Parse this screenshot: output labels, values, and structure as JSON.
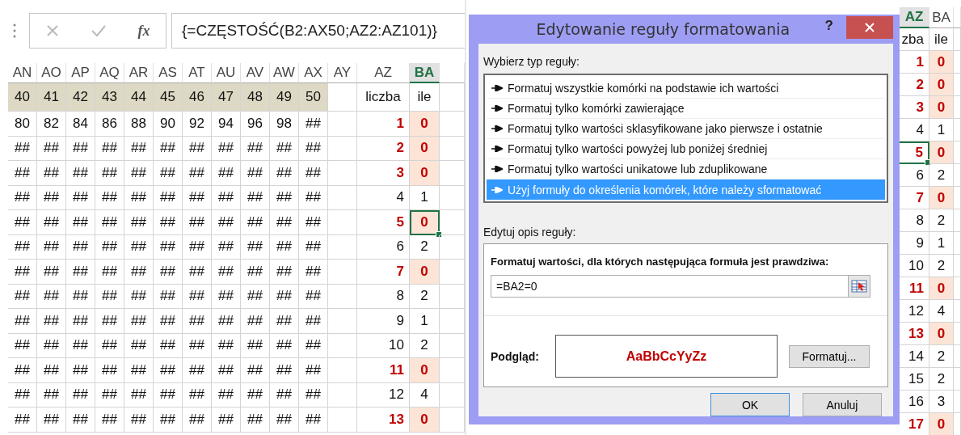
{
  "left_sheet": {
    "formula_bar": {
      "function_label": "fx",
      "formula": "{=CZĘSTOŚĆ(B2:AX50;AZ2:AZ101)}"
    },
    "columns": [
      {
        "label": "AN",
        "selected": false
      },
      {
        "label": "AO",
        "selected": false
      },
      {
        "label": "AP",
        "selected": false
      },
      {
        "label": "AQ",
        "selected": false
      },
      {
        "label": "AR",
        "selected": false
      },
      {
        "label": "AS",
        "selected": false
      },
      {
        "label": "AT",
        "selected": false
      },
      {
        "label": "AU",
        "selected": false
      },
      {
        "label": "AV",
        "selected": false
      },
      {
        "label": "AW",
        "selected": false
      },
      {
        "label": "AX",
        "selected": false
      },
      {
        "label": "AY",
        "selected": false
      },
      {
        "label": "AZ",
        "selected": false
      },
      {
        "label": "BA",
        "selected": true
      }
    ],
    "header_row": {
      "cells": [
        "40",
        "41",
        "42",
        "43",
        "44",
        "45",
        "46",
        "47",
        "48",
        "49",
        "50"
      ],
      "az": "liczba",
      "ba": "ile"
    },
    "rows": [
      {
        "cells": [
          "80",
          "82",
          "84",
          "86",
          "88",
          "90",
          "92",
          "94",
          "96",
          "98",
          "##"
        ],
        "az": "1",
        "ba": "0",
        "highlight": true,
        "ba_selected": false
      },
      {
        "cells": [
          "##",
          "##",
          "##",
          "##",
          "##",
          "##",
          "##",
          "##",
          "##",
          "##",
          "##"
        ],
        "az": "2",
        "ba": "0",
        "highlight": true,
        "ba_selected": false
      },
      {
        "cells": [
          "##",
          "##",
          "##",
          "##",
          "##",
          "##",
          "##",
          "##",
          "##",
          "##",
          "##"
        ],
        "az": "3",
        "ba": "0",
        "highlight": true,
        "ba_selected": false
      },
      {
        "cells": [
          "##",
          "##",
          "##",
          "##",
          "##",
          "##",
          "##",
          "##",
          "##",
          "##",
          "##"
        ],
        "az": "4",
        "ba": "1",
        "highlight": false,
        "ba_selected": false
      },
      {
        "cells": [
          "##",
          "##",
          "##",
          "##",
          "##",
          "##",
          "##",
          "##",
          "##",
          "##",
          "##"
        ],
        "az": "5",
        "ba": "0",
        "highlight": true,
        "ba_selected": true
      },
      {
        "cells": [
          "##",
          "##",
          "##",
          "##",
          "##",
          "##",
          "##",
          "##",
          "##",
          "##",
          "##"
        ],
        "az": "6",
        "ba": "2",
        "highlight": false,
        "ba_selected": false
      },
      {
        "cells": [
          "##",
          "##",
          "##",
          "##",
          "##",
          "##",
          "##",
          "##",
          "##",
          "##",
          "##"
        ],
        "az": "7",
        "ba": "0",
        "highlight": true,
        "ba_selected": false
      },
      {
        "cells": [
          "##",
          "##",
          "##",
          "##",
          "##",
          "##",
          "##",
          "##",
          "##",
          "##",
          "##"
        ],
        "az": "8",
        "ba": "2",
        "highlight": false,
        "ba_selected": false
      },
      {
        "cells": [
          "##",
          "##",
          "##",
          "##",
          "##",
          "##",
          "##",
          "##",
          "##",
          "##",
          "##"
        ],
        "az": "9",
        "ba": "1",
        "highlight": false,
        "ba_selected": false
      },
      {
        "cells": [
          "##",
          "##",
          "##",
          "##",
          "##",
          "##",
          "##",
          "##",
          "##",
          "##",
          "##"
        ],
        "az": "10",
        "ba": "2",
        "highlight": false,
        "ba_selected": false
      },
      {
        "cells": [
          "##",
          "##",
          "##",
          "##",
          "##",
          "##",
          "##",
          "##",
          "##",
          "##",
          "##"
        ],
        "az": "11",
        "ba": "0",
        "highlight": true,
        "ba_selected": false
      },
      {
        "cells": [
          "##",
          "##",
          "##",
          "##",
          "##",
          "##",
          "##",
          "##",
          "##",
          "##",
          "##"
        ],
        "az": "12",
        "ba": "4",
        "highlight": false,
        "ba_selected": false
      },
      {
        "cells": [
          "##",
          "##",
          "##",
          "##",
          "##",
          "##",
          "##",
          "##",
          "##",
          "##",
          "##"
        ],
        "az": "13",
        "ba": "0",
        "highlight": true,
        "ba_selected": false
      }
    ]
  },
  "dialog": {
    "title": "Edytowanie reguły formatowania",
    "help": "?",
    "rule_type_label": "Wybierz typ reguły:",
    "rule_types": [
      {
        "label": "Formatuj wszystkie komórki na podstawie ich wartości",
        "selected": false
      },
      {
        "label": "Formatuj tylko komórki zawierające",
        "selected": false
      },
      {
        "label": "Formatuj tylko wartości sklasyfikowane jako pierwsze i ostatnie",
        "selected": false
      },
      {
        "label": "Formatuj tylko wartości powyżej lub poniżej średniej",
        "selected": false
      },
      {
        "label": "Formatuj tylko wartości unikatowe lub zduplikowane",
        "selected": false
      },
      {
        "label": "Użyj formuły do określenia komórek, które należy sformatować",
        "selected": true
      }
    ],
    "description_label": "Edytuj opis reguły:",
    "formula_label": "Formatuj wartości, dla których następująca formuła jest prawdziwa:",
    "formula": "=BA2=0",
    "preview_label": "Podgląd:",
    "preview_text": "AaBbCcYyZz",
    "format_button": "Formatuj...",
    "buttons": [
      {
        "label": "OK",
        "default": true
      },
      {
        "label": "Anuluj",
        "default": false
      }
    ]
  },
  "right_sheet": {
    "columns": [
      {
        "label": "AZ",
        "selected": true
      },
      {
        "label": "BA",
        "selected": false
      }
    ],
    "header_row": {
      "az": "zba",
      "ba": "ile"
    },
    "rows": [
      {
        "az": "1",
        "ba": "0",
        "highlight": true,
        "az_selected": false
      },
      {
        "az": "2",
        "ba": "0",
        "highlight": true,
        "az_selected": false
      },
      {
        "az": "3",
        "ba": "0",
        "highlight": true,
        "az_selected": false
      },
      {
        "az": "4",
        "ba": "1",
        "highlight": false,
        "az_selected": false
      },
      {
        "az": "5",
        "ba": "0",
        "highlight": true,
        "az_selected": true
      },
      {
        "az": "6",
        "ba": "2",
        "highlight": false,
        "az_selected": false
      },
      {
        "az": "7",
        "ba": "0",
        "highlight": true,
        "az_selected": false
      },
      {
        "az": "8",
        "ba": "2",
        "highlight": false,
        "az_selected": false
      },
      {
        "az": "9",
        "ba": "1",
        "highlight": false,
        "az_selected": false
      },
      {
        "az": "10",
        "ba": "2",
        "highlight": false,
        "az_selected": false
      },
      {
        "az": "11",
        "ba": "0",
        "highlight": true,
        "az_selected": false
      },
      {
        "az": "12",
        "ba": "4",
        "highlight": false,
        "az_selected": false
      },
      {
        "az": "13",
        "ba": "0",
        "highlight": true,
        "az_selected": false
      },
      {
        "az": "14",
        "ba": "2",
        "highlight": false,
        "az_selected": false
      },
      {
        "az": "15",
        "ba": "2",
        "highlight": false,
        "az_selected": false
      },
      {
        "az": "16",
        "ba": "3",
        "highlight": false,
        "az_selected": false
      },
      {
        "az": "17",
        "ba": "0",
        "highlight": true,
        "az_selected": false
      }
    ]
  }
}
